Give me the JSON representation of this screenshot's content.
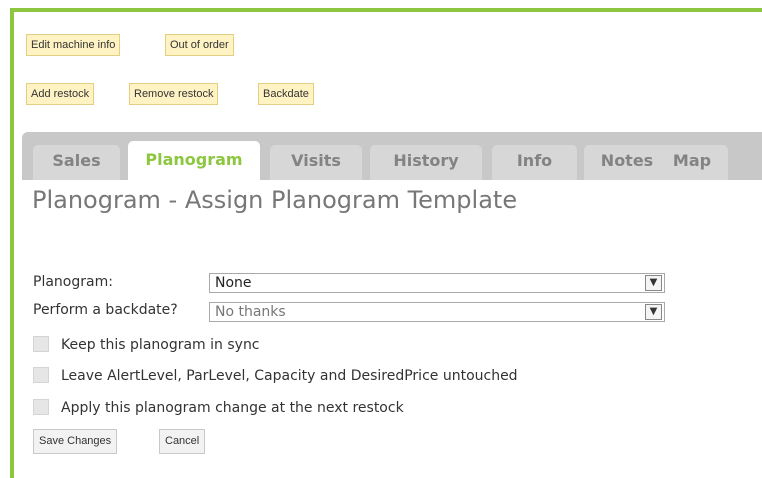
{
  "actions": {
    "edit_machine_info": "Edit machine info",
    "out_of_order": "Out of order",
    "add_restock": "Add restock",
    "remove_restock": "Remove restock",
    "backdate": "Backdate"
  },
  "tabs": [
    {
      "label": "Sales",
      "active": false
    },
    {
      "label": "Planogram",
      "active": true
    },
    {
      "label": "Visits",
      "active": false
    },
    {
      "label": "History",
      "active": false
    },
    {
      "label": "Info",
      "active": false
    },
    {
      "label": "Notes",
      "active": false
    },
    {
      "label": "Map",
      "active": false
    }
  ],
  "page": {
    "title": "Planogram - Assign Planogram Template"
  },
  "form": {
    "planogram_label": "Planogram:",
    "planogram_value": "None",
    "backdate_label": "Perform a backdate?",
    "backdate_value": "No thanks",
    "options": [
      {
        "label": "Keep this planogram in sync",
        "checked": false
      },
      {
        "label": "Leave AlertLevel, ParLevel, Capacity and DesiredPrice untouched",
        "checked": false
      },
      {
        "label": "Apply this planogram change at the next restock",
        "checked": false
      }
    ],
    "save_label": "Save Changes",
    "cancel_label": "Cancel"
  },
  "colors": {
    "accent": "#8dc63f",
    "action_button_bg": "#fff3c4",
    "tab_bar": "#c8c8c8"
  }
}
